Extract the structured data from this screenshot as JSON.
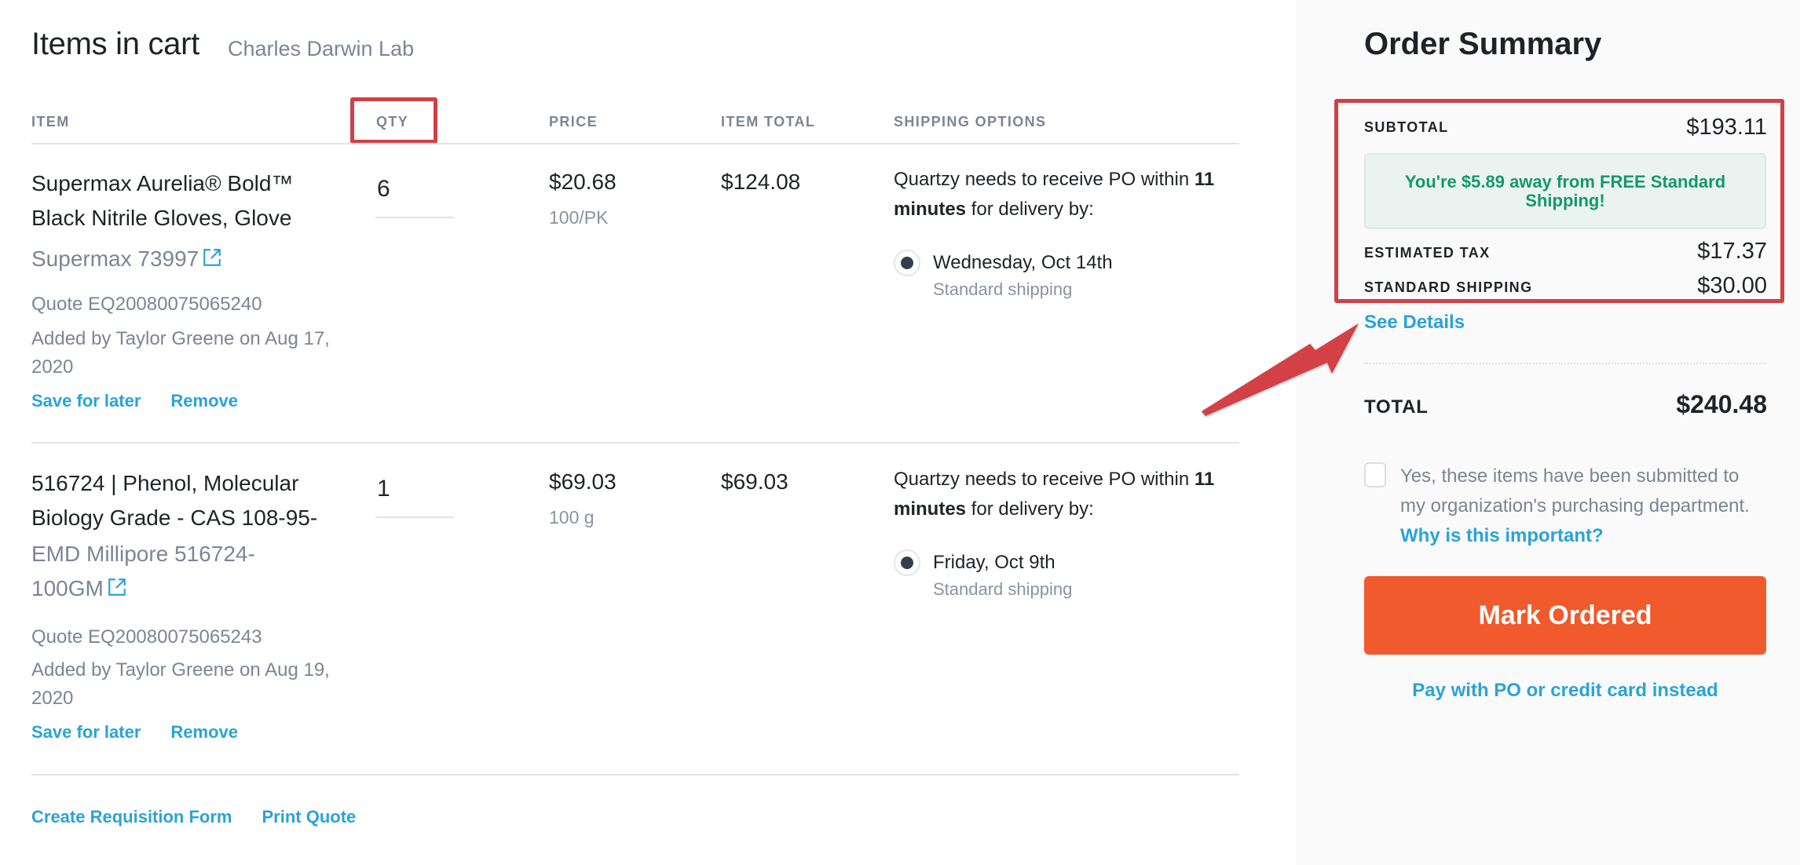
{
  "header": {
    "title": "Items in cart",
    "lab": "Charles Darwin Lab"
  },
  "table": {
    "columns": [
      "ITEM",
      "QTY",
      "PRICE",
      "ITEM TOTAL",
      "SHIPPING OPTIONS"
    ]
  },
  "items": [
    {
      "name": "Supermax Aurelia® Bold™ Black Nitrile Gloves, Glove",
      "sku": "Supermax 73997",
      "quote": "Quote EQ20080075065240",
      "added": "Added by Taylor Greene on Aug 17, 2020",
      "save_label": "Save for later",
      "remove_label": "Remove",
      "qty": "6",
      "price": "$20.68",
      "unit": "100/PK",
      "item_total": "$124.08",
      "ship_prefix": "Quartzy needs to receive PO within ",
      "ship_bold1": "11",
      "ship_bold2": "minutes",
      "ship_suffix": " for delivery by:",
      "ship_date": "Wednesday, Oct 14th",
      "ship_method": "Standard shipping"
    },
    {
      "name": "516724 | Phenol, Molecular Biology Grade - CAS 108-95-",
      "sku": "EMD Millipore 516724-100GM",
      "quote": "Quote EQ20080075065243",
      "added": "Added by Taylor Greene on Aug 19, 2020",
      "save_label": "Save for later",
      "remove_label": "Remove",
      "qty": "1",
      "price": "$69.03",
      "unit": "100 g",
      "item_total": "$69.03",
      "ship_prefix": "Quartzy needs to receive PO within ",
      "ship_bold1": "11",
      "ship_bold2": "minutes",
      "ship_suffix": " for delivery by:",
      "ship_date": "Friday, Oct 9th",
      "ship_method": "Standard shipping"
    }
  ],
  "footer": {
    "requisition_label": "Create Requisition Form",
    "print_label": "Print Quote"
  },
  "summary": {
    "title": "Order Summary",
    "subtotal_label": "SUBTOTAL",
    "subtotal": "$193.11",
    "free_shipping_notice": "You're $5.89 away from FREE Standard Shipping!",
    "tax_label": "ESTIMATED TAX",
    "tax": "$17.37",
    "shipping_label": "STANDARD SHIPPING",
    "shipping": "$30.00",
    "see_details": "See Details",
    "total_label": "TOTAL",
    "total": "$240.48",
    "confirm_text": "Yes, these items have been submitted to my organization's purchasing department. ",
    "confirm_link": "Why is this important?",
    "confirm_checked": false,
    "mark_ordered_label": "Mark Ordered",
    "pay_alt_label": "Pay with PO or credit card instead"
  },
  "colors": {
    "accent_link": "#2aa3d8",
    "primary_button": "#f05a2c",
    "annotation": "#d33f45",
    "success_text": "#13996b"
  }
}
